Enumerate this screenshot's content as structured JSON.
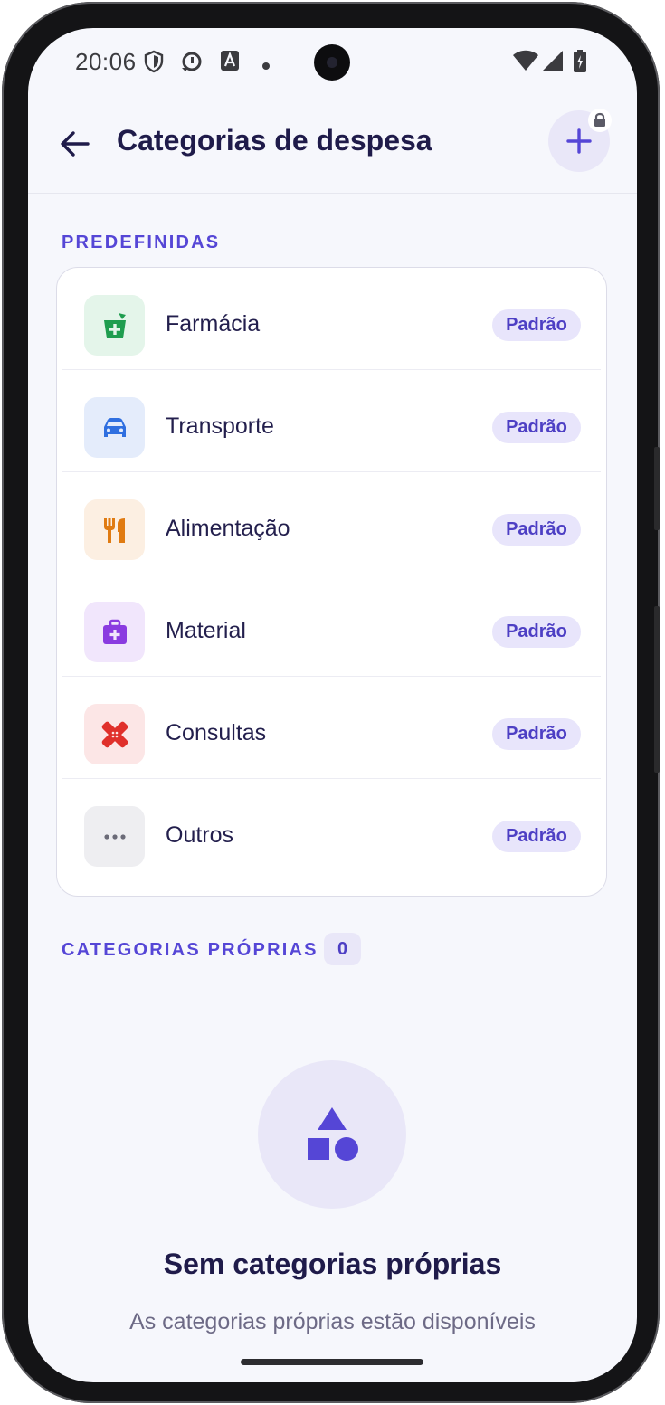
{
  "status_bar": {
    "time": "20:06"
  },
  "header": {
    "title": "Categorias de despesa"
  },
  "sections": {
    "predefined_label": "PREDEFINIDAS",
    "own_label": "CATEGORIAS PRÓPRIAS",
    "own_count": "0"
  },
  "categories": [
    {
      "name": "Farmácia",
      "badge": "Padrão",
      "icon": "pharmacy-icon",
      "icon_color": "#1f9d4f",
      "tile_color": "#e4f5ea"
    },
    {
      "name": "Transporte",
      "badge": "Padrão",
      "icon": "car-icon",
      "icon_color": "#2f6fe0",
      "tile_color": "#e4ecfb"
    },
    {
      "name": "Alimentação",
      "badge": "Padrão",
      "icon": "utensils-icon",
      "icon_color": "#e07b12",
      "tile_color": "#fcefe2"
    },
    {
      "name": "Material",
      "badge": "Padrão",
      "icon": "medical-kit-icon",
      "icon_color": "#8a3be0",
      "tile_color": "#f1e6fc"
    },
    {
      "name": "Consultas",
      "badge": "Padrão",
      "icon": "bandage-icon",
      "icon_color": "#e0302b",
      "tile_color": "#fce6e6"
    },
    {
      "name": "Outros",
      "badge": "Padrão",
      "icon": "more-icon",
      "icon_color": "#6b6b78",
      "tile_color": "#eeeef1"
    }
  ],
  "empty_state": {
    "title": "Sem categorias próprias",
    "description": "As categorias próprias estão disponíveis",
    "icon": "shapes-icon"
  },
  "colors": {
    "accent": "#5546d6",
    "title": "#1f1b4a",
    "background": "#f6f7fc"
  }
}
